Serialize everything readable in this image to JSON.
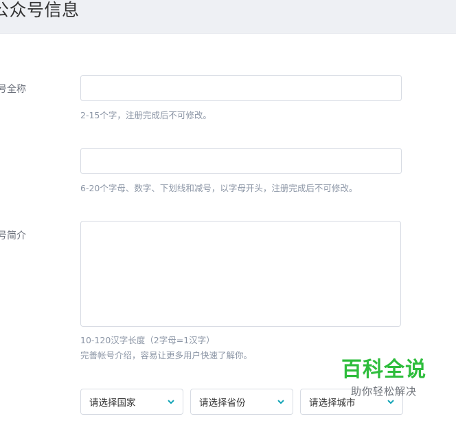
{
  "header": {
    "title": "公众号信息"
  },
  "form": {
    "name": {
      "label": "号全称",
      "value": "",
      "hint": "2-15个字，注册完成后不可修改。"
    },
    "wechat_id": {
      "value": "",
      "hint": "6-20个字母、数字、下划线和减号，以字母开头，注册完成后不可修改。"
    },
    "intro": {
      "label": "号简介",
      "value": "",
      "hint_line1": "10-120汉字长度（2字母=1汉字）",
      "hint_line2": "完善帐号介绍，容易让更多用户快速了解你。"
    },
    "location": {
      "mark": "·",
      "country_placeholder": "请选择国家",
      "province_placeholder": "请选择省份",
      "city_placeholder": "请选择城市"
    }
  },
  "watermark": {
    "main": "百科全说",
    "sub": "助你轻松解决"
  },
  "colors": {
    "header_bg": "#eef0f4",
    "chevron": "#12a4b6",
    "watermark_green": "#2ebd3c"
  },
  "icons": {
    "select_chevron": "chevron-down-icon"
  }
}
